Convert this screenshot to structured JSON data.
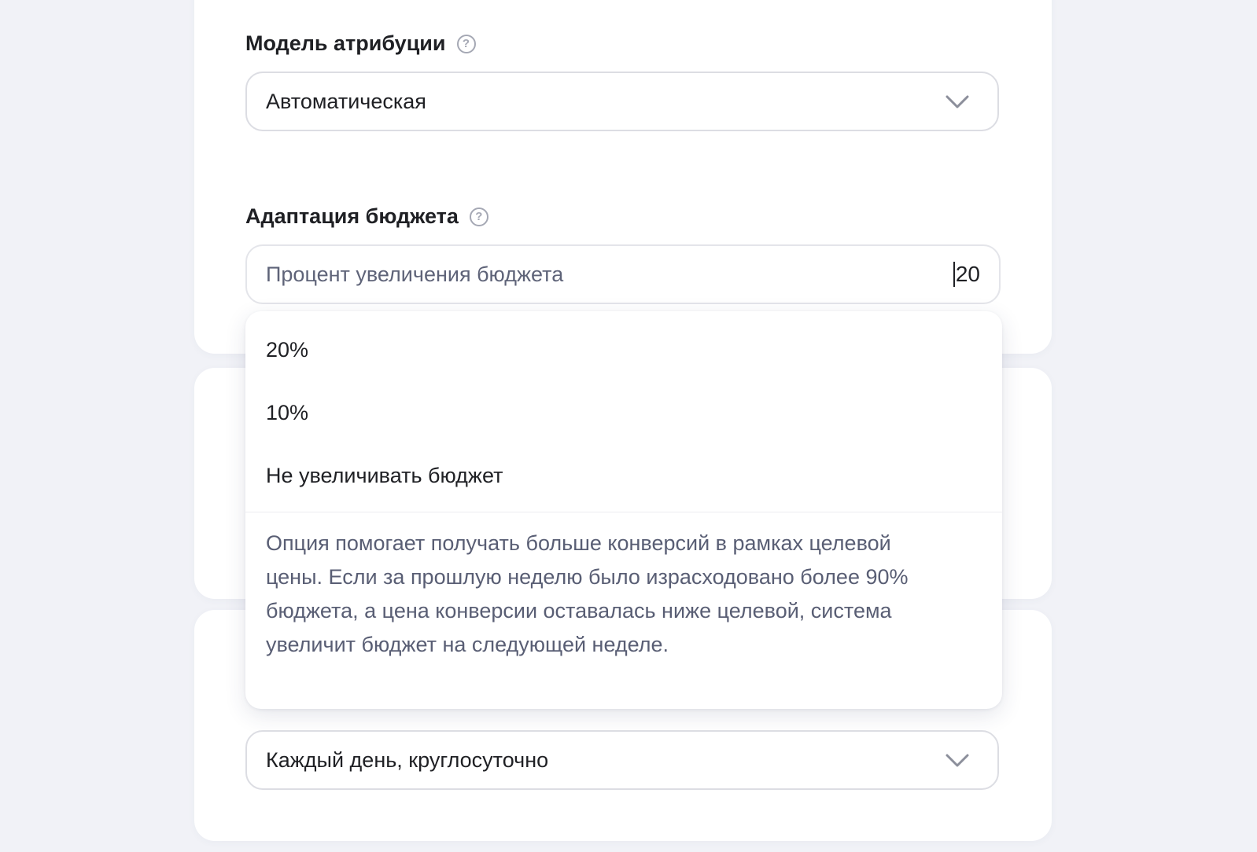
{
  "attribution": {
    "label": "Модель атрибуции",
    "help_icon": "question-circle-icon",
    "selected": "Автоматическая"
  },
  "budget_adaptation": {
    "label": "Адаптация бюджета",
    "help_icon": "question-circle-icon",
    "input_placeholder": "Процент увеличения бюджета",
    "input_value": "20",
    "options": [
      {
        "label": "20%"
      },
      {
        "label": "10%"
      },
      {
        "label": "Не увеличивать бюджет"
      }
    ],
    "hint": "Опция помогает получать больше конверсий в рамках целевой цены. Если за прошлую неделю было израсходовано более 90% бюджета, а цена конверсии оставалась ниже целевой, система увеличит бюджет на следующей неделе."
  },
  "schedule": {
    "selected": "Каждый день, круглосуточно"
  },
  "colors": {
    "background": "#f1f2f7",
    "card": "#ffffff",
    "border": "#dcdde3",
    "text": "#1f2024",
    "muted_text": "#595e74"
  }
}
